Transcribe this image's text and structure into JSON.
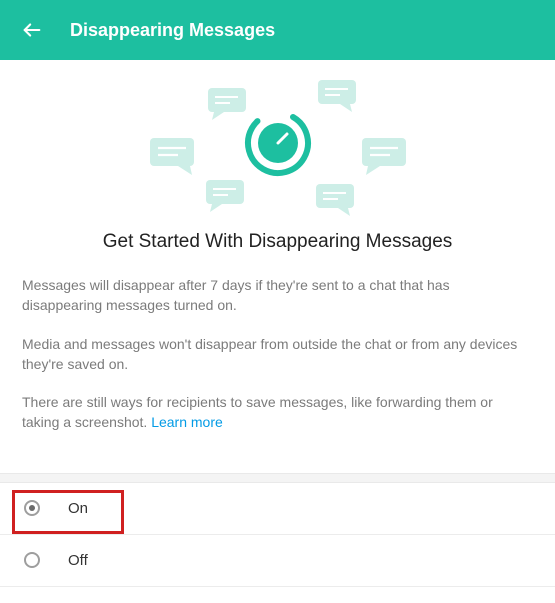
{
  "header": {
    "title": "Disappearing Messages"
  },
  "content": {
    "heading": "Get Started With Disappearing Messages",
    "para1": "Messages will disappear after 7 days if they're sent to a chat that has disappearing messages turned on.",
    "para2": "Media and messages won't disappear from outside the chat or from any devices they're saved on.",
    "para3_prefix": "There are still ways for recipients to save messages, like forwarding them or taking a screenshot. ",
    "learn_more": "Learn more"
  },
  "options": {
    "on": "On",
    "off": "Off",
    "selected": "on"
  },
  "colors": {
    "accent": "#1dbfa0",
    "highlight": "#d02020"
  }
}
